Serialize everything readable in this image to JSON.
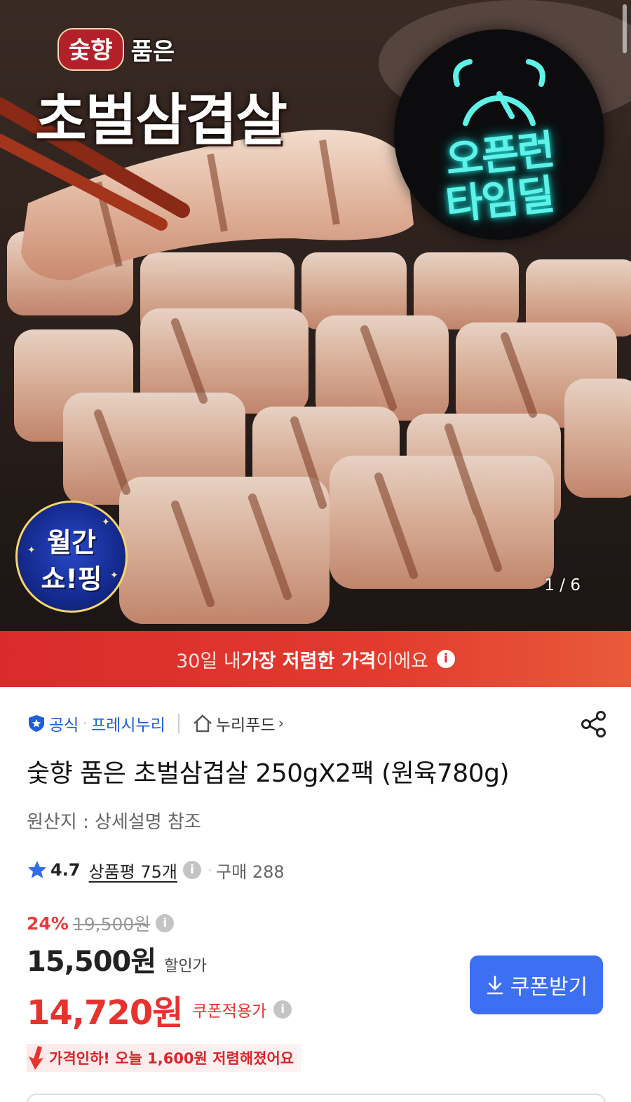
{
  "hero": {
    "logo_badge": "숯향",
    "logo_poom": "품은",
    "logo_main": "초벌삼겹살",
    "timedeal_line1": "오픈런",
    "timedeal_line2": "타임딜",
    "monthly_line1": "월간",
    "monthly_line2": "쇼!핑",
    "pager": "1 / 6"
  },
  "banner": {
    "prefix": "30일 내 ",
    "bold": "가장 저렴한 가격",
    "suffix": "이에요",
    "info": "i"
  },
  "brand": {
    "official": "공식",
    "seller": "프레시누리",
    "store": "누리푸드",
    "chevron": "›"
  },
  "product": {
    "title": "숯향 품은 초벌삼겹살 250gX2팩 (원육780g)",
    "origin": "원산지 : 상세설명 참조"
  },
  "rating": {
    "score": "4.7",
    "reviews": "상품평 75개",
    "purchases": "구매 288",
    "info": "i"
  },
  "price": {
    "discount_rate": "24%",
    "original": "19,500원",
    "sale": "15,500원",
    "sale_label": "할인가",
    "coupon": "14,720원",
    "coupon_label": "쿠폰적용가",
    "info": "i",
    "coupon_button": "쿠폰받기",
    "price_drop": "가격인하! 오늘 1,600원 저렴해졌어요"
  },
  "colors": {
    "accent_blue": "#3d6ff2",
    "brand_blue": "#1e5fd9",
    "sale_red": "#e8322e",
    "banner_red": "#d92b2b"
  }
}
